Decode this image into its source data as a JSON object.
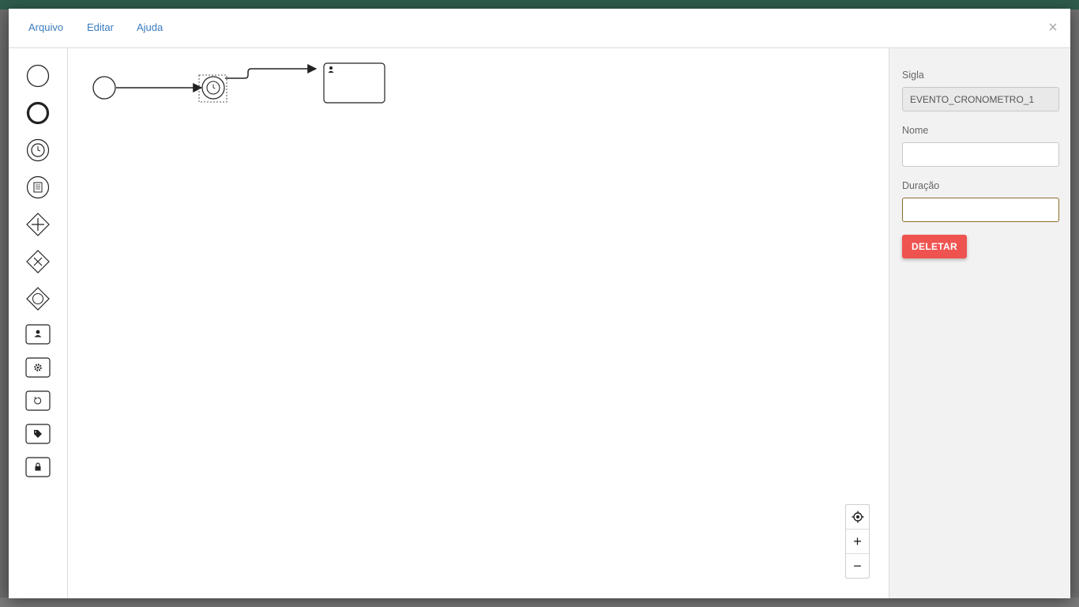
{
  "menu": {
    "items": [
      {
        "label": "Arquivo"
      },
      {
        "label": "Editar"
      },
      {
        "label": "Ajuda"
      }
    ],
    "close_label": "×"
  },
  "palette": {
    "tools": [
      {
        "icon": "start-event-icon"
      },
      {
        "icon": "end-event-icon"
      },
      {
        "icon": "timer-event-icon"
      },
      {
        "icon": "message-event-icon"
      },
      {
        "icon": "parallel-gateway-icon"
      },
      {
        "icon": "exclusive-gateway-icon"
      },
      {
        "icon": "inclusive-gateway-icon"
      },
      {
        "icon": "user-task-icon"
      },
      {
        "icon": "service-task-icon"
      },
      {
        "icon": "loop-task-icon"
      },
      {
        "icon": "tag-task-icon"
      },
      {
        "icon": "lock-task-icon"
      }
    ]
  },
  "zoom": {
    "fit_icon": "target-icon",
    "zoom_in_label": "+",
    "zoom_out_label": "−"
  },
  "properties": {
    "sigla_label": "Sigla",
    "sigla_value": "EVENTO_CRONOMETRO_1",
    "nome_label": "Nome",
    "nome_value": "",
    "duracao_label": "Duração",
    "duracao_value": "",
    "delete_label": "DELETAR"
  },
  "colors": {
    "accent_link": "#3a7bbf",
    "delete": "#ef5350",
    "header_backdrop": "#2e5b4c"
  }
}
